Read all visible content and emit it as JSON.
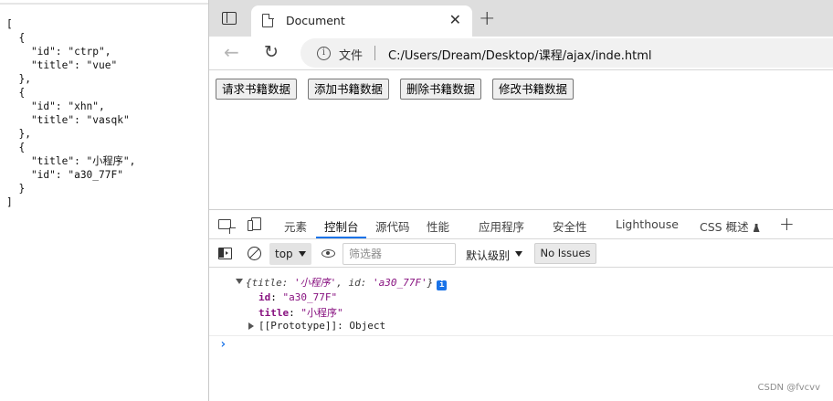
{
  "json_panel": {
    "lines": [
      "[",
      "  {",
      "    \"id\": \"ctrp\",",
      "    \"title\": \"vue\"",
      "  },",
      "  {",
      "    \"id\": \"xhn\",",
      "    \"title\": \"vasqk\"",
      "  },",
      "  {",
      "    \"title\": \"小程序\",",
      "    \"id\": \"a30_77F\"",
      "  }",
      "]"
    ]
  },
  "browser": {
    "tab": {
      "title": "Document",
      "close": "✕",
      "favicon_icon": "document-icon"
    },
    "new_tab": "+",
    "nav": {
      "back": "←",
      "reload": "↻"
    },
    "address": {
      "info_icon": "i",
      "file_label": "文件",
      "url": "C:/Users/Dream/Desktop/课程/ajax/inde.html"
    },
    "page": {
      "buttons": [
        "请求书籍数据",
        "添加书籍数据",
        "删除书籍数据",
        "修改书籍数据"
      ]
    }
  },
  "devtools": {
    "tabs": [
      "元素",
      "控制台",
      "源代码",
      "性能",
      "应用程序",
      "安全性",
      "Lighthouse",
      "CSS 概述"
    ],
    "active_tab": "控制台",
    "plus": "+",
    "console_toolbar": {
      "context": "top",
      "filter_placeholder": "筛选器",
      "levels": "默认级别",
      "issues": "No Issues"
    },
    "console": {
      "summary_open": "{",
      "summary_k1": "title: ",
      "summary_v1": "'小程序'",
      "summary_sep": ", ",
      "summary_k2": "id: ",
      "summary_v2": "'a30_77F'",
      "summary_close": "}",
      "info_badge": "i",
      "props": [
        {
          "key": "id",
          "value": "\"a30_77F\""
        },
        {
          "key": "title",
          "value": "\"小程序\""
        }
      ],
      "prototype": "[[Prototype]]: Object",
      "prompt": "›"
    }
  },
  "watermark": "CSDN @fvcvv"
}
